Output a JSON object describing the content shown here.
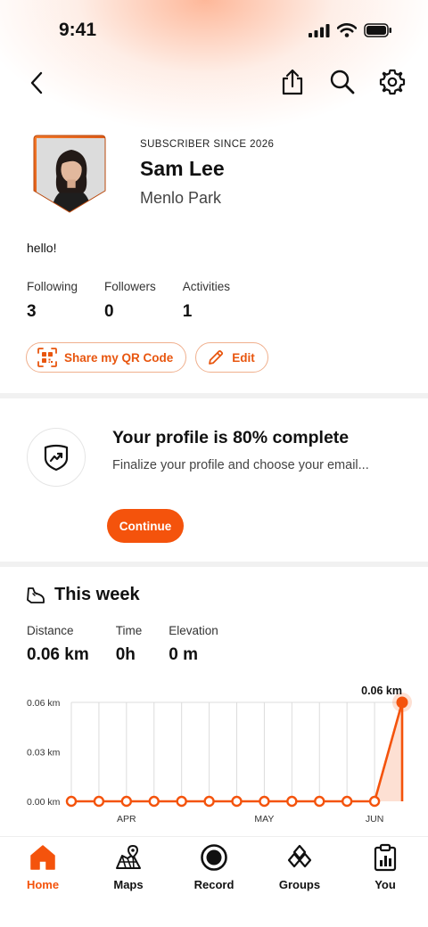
{
  "status_bar": {
    "time": "9:41"
  },
  "profile": {
    "subscriber_since": "SUBSCRIBER SINCE 2026",
    "name": "Sam Lee",
    "city": "Menlo Park",
    "bio": "hello!"
  },
  "stats": [
    {
      "label": "Following",
      "value": "3"
    },
    {
      "label": "Followers",
      "value": "0"
    },
    {
      "label": "Activities",
      "value": "1"
    }
  ],
  "actions": {
    "share_qr_label": "Share my QR Code",
    "edit_label": "Edit"
  },
  "profile_completion": {
    "title": "Your profile is 80% complete",
    "description": "Finalize your profile and choose your email...",
    "button_label": "Continue",
    "percent": 80
  },
  "this_week": {
    "title": "This week",
    "stats": [
      {
        "label": "Distance",
        "value": "0.06 km"
      },
      {
        "label": "Time",
        "value": "0h"
      },
      {
        "label": "Elevation",
        "value": "0 m"
      }
    ]
  },
  "chart_data": {
    "type": "area",
    "y_tick_labels": [
      "0.06 km",
      "0.03 km",
      "0.00 km"
    ],
    "y_ticks": [
      0.06,
      0.03,
      0
    ],
    "ylim": [
      0,
      0.06
    ],
    "x_tick_labels": [
      "APR",
      "MAY",
      "JUN"
    ],
    "x_tick_indices": [
      2,
      7,
      11
    ],
    "values": [
      0,
      0,
      0,
      0,
      0,
      0,
      0,
      0,
      0,
      0,
      0,
      0,
      0.06
    ],
    "peak_label": "0.06 km",
    "accent_color": "#f4530c",
    "grid": true
  },
  "nav": {
    "items": [
      {
        "label": "Home",
        "icon": "home-icon",
        "active": true
      },
      {
        "label": "Maps",
        "icon": "map-icon",
        "active": false
      },
      {
        "label": "Record",
        "icon": "record-icon",
        "active": false
      },
      {
        "label": "Groups",
        "icon": "groups-icon",
        "active": false
      },
      {
        "label": "You",
        "icon": "you-icon",
        "active": false
      }
    ]
  },
  "colors": {
    "accent": "#f4530c",
    "accent_border": "#f0b08e"
  }
}
